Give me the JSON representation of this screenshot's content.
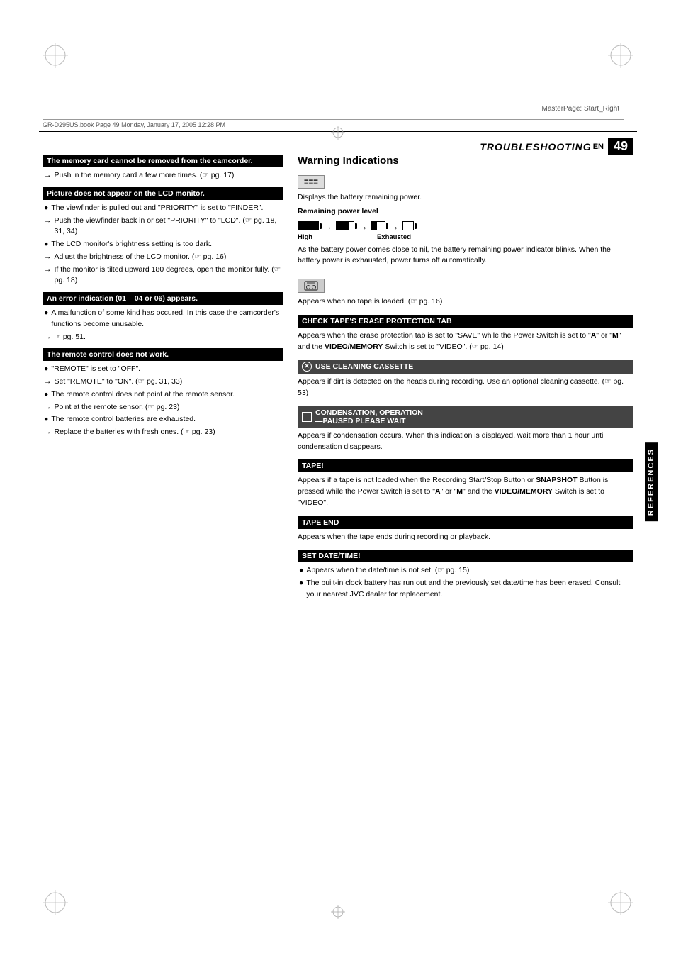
{
  "meta": {
    "master_page": "MasterPage: Start_Right",
    "file_info": "GR-D295US.book  Page 49  Monday, January 17, 2005  12:28 PM"
  },
  "header": {
    "section": "TROUBLESHOOTING",
    "en_label": "EN",
    "page_number": "49"
  },
  "references_label": "REFERENCES",
  "left_column": {
    "sections": [
      {
        "id": "memory-card",
        "header": "The memory card cannot be removed from the camcorder.",
        "items": [
          {
            "type": "arrow",
            "text": "Push in the memory card a few more times. (☞ pg. 17)"
          }
        ]
      },
      {
        "id": "lcd-monitor",
        "header": "Picture does not appear on the LCD monitor.",
        "items": [
          {
            "type": "bullet",
            "text": "The viewfinder is pulled out and \"PRIORITY\" is set to \"FINDER\"."
          },
          {
            "type": "arrow",
            "text": "Push the viewfinder back in or set \"PRIORITY\" to \"LCD\". (☞ pg. 18, 31, 34)"
          },
          {
            "type": "bullet",
            "text": "The LCD monitor's brightness setting is too dark."
          },
          {
            "type": "arrow",
            "text": "Adjust the brightness of the LCD monitor. (☞ pg. 16)"
          },
          {
            "type": "arrow",
            "text": "If the monitor is tilted upward 180 degrees, open the monitor fully. (☞ pg. 18)"
          }
        ]
      },
      {
        "id": "error-indication",
        "header": "An error indication (01 – 04 or 06) appears.",
        "items": [
          {
            "type": "bullet",
            "text": "A malfunction of some kind has occured. In this case the camcorder's functions become unusable."
          },
          {
            "type": "arrow",
            "text": "☞ pg. 51."
          }
        ]
      },
      {
        "id": "remote-control",
        "header": "The remote control does not work.",
        "items": [
          {
            "type": "bullet",
            "text": "\"REMOTE\" is set to \"OFF\"."
          },
          {
            "type": "arrow",
            "text": "Set \"REMOTE\" to \"ON\". (☞ pg. 31, 33)"
          },
          {
            "type": "bullet",
            "text": "The remote control does not point at the remote sensor."
          },
          {
            "type": "arrow",
            "text": "Point at the remote sensor. (☞ pg. 23)"
          },
          {
            "type": "bullet",
            "text": "The remote control batteries are exhausted."
          },
          {
            "type": "arrow",
            "text": "Replace the batteries with fresh ones. (☞ pg. 23)"
          }
        ]
      }
    ]
  },
  "right_column": {
    "heading": "Warning Indications",
    "sections": [
      {
        "id": "battery-indicator",
        "icon_label": "≡≡≡",
        "description": "Displays the battery remaining power.",
        "battery_label": "Remaining power level",
        "battery_levels": [
          "High",
          "→",
          "→",
          "→",
          "Exhausted"
        ],
        "detail": "As the battery power comes close to nil, the battery remaining power indicator blinks. When the battery power is exhausted, power turns off automatically."
      },
      {
        "id": "no-tape",
        "icon_label": "⊡",
        "description": "Appears when no tape is loaded. (☞ pg. 16)"
      },
      {
        "id": "check-tape",
        "header": "CHECK TAPE'S ERASE PROTECTION TAB",
        "header_style": "black",
        "description": "Appears when the erase protection tab is set to \"SAVE\" while the Power Switch is set to \"A\" or \"M\" and the VIDEO/MEMORY Switch is set to \"VIDEO\". (☞ pg. 14)"
      },
      {
        "id": "use-cleaning",
        "header": "⊗ USE CLEANING CASSETTE",
        "header_style": "dark",
        "description": "Appears if dirt is detected on the heads during recording. Use an optional cleaning cassette. (☞ pg. 53)"
      },
      {
        "id": "condensation",
        "header": "⬜ CONDENSATION, OPERATION\n—PAUSED PLEASE WAIT",
        "header_style": "dark",
        "description": "Appears if condensation occurs. When this indication is displayed, wait more than 1 hour until condensation disappears."
      },
      {
        "id": "tape-warning",
        "header": "TAPE!",
        "header_style": "black",
        "description": "Appears if a tape is not loaded when the Recording Start/Stop Button or SNAPSHOT Button is pressed while the Power Switch is set to \"A\" or \"M\" and the VIDEO/MEMORY Switch is set to \"VIDEO\"."
      },
      {
        "id": "tape-end",
        "header": "TAPE END",
        "header_style": "black",
        "description": "Appears when the tape ends during recording or playback."
      },
      {
        "id": "set-date-time",
        "header": "SET DATE/TIME!",
        "header_style": "black",
        "items": [
          {
            "type": "bullet",
            "text": "Appears when the date/time is not set. (☞ pg. 15)"
          },
          {
            "type": "bullet",
            "text": "The built-in clock battery has run out and the previously set date/time has been erased. Consult your nearest JVC dealer for replacement."
          }
        ]
      }
    ]
  }
}
